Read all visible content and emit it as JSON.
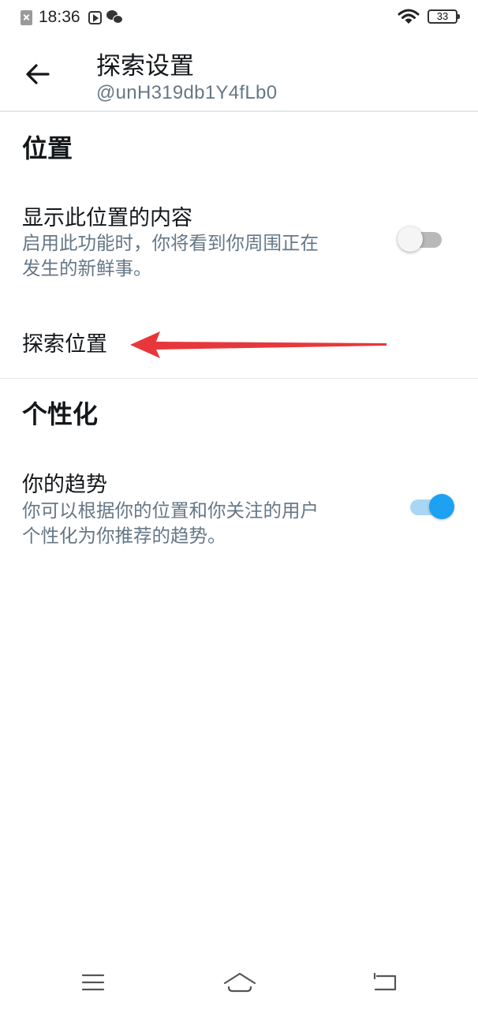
{
  "status_bar": {
    "time": "18:36",
    "battery": "33",
    "icons": [
      "close-notification-icon",
      "play-icon",
      "wechat-icon",
      "wifi-icon",
      "battery-icon"
    ]
  },
  "header": {
    "title": "探索设置",
    "subtitle": "@unH319db1Y4fLb0",
    "back_icon": "arrow-left-icon"
  },
  "sections": {
    "location": {
      "title": "位置",
      "show_content": {
        "title": "显示此位置的内容",
        "desc_line1": "启用此功能时，你将看到你周围正在",
        "desc_line2": "发生的新鲜事。",
        "enabled": false
      },
      "explore_location": {
        "title": "探索位置"
      }
    },
    "personalization": {
      "title": "个性化",
      "trends": {
        "title": "你的趋势",
        "desc_line1": "你可以根据你的位置和你关注的用户",
        "desc_line2": "个性化为你推荐的趋势。",
        "enabled": true
      }
    }
  },
  "colors": {
    "accent": "#1da1f2",
    "annotation_arrow": "#e8373a",
    "secondary_text": "#657786"
  },
  "nav_bar": {
    "icons": [
      "menu-icon",
      "home-icon",
      "back-icon"
    ]
  }
}
